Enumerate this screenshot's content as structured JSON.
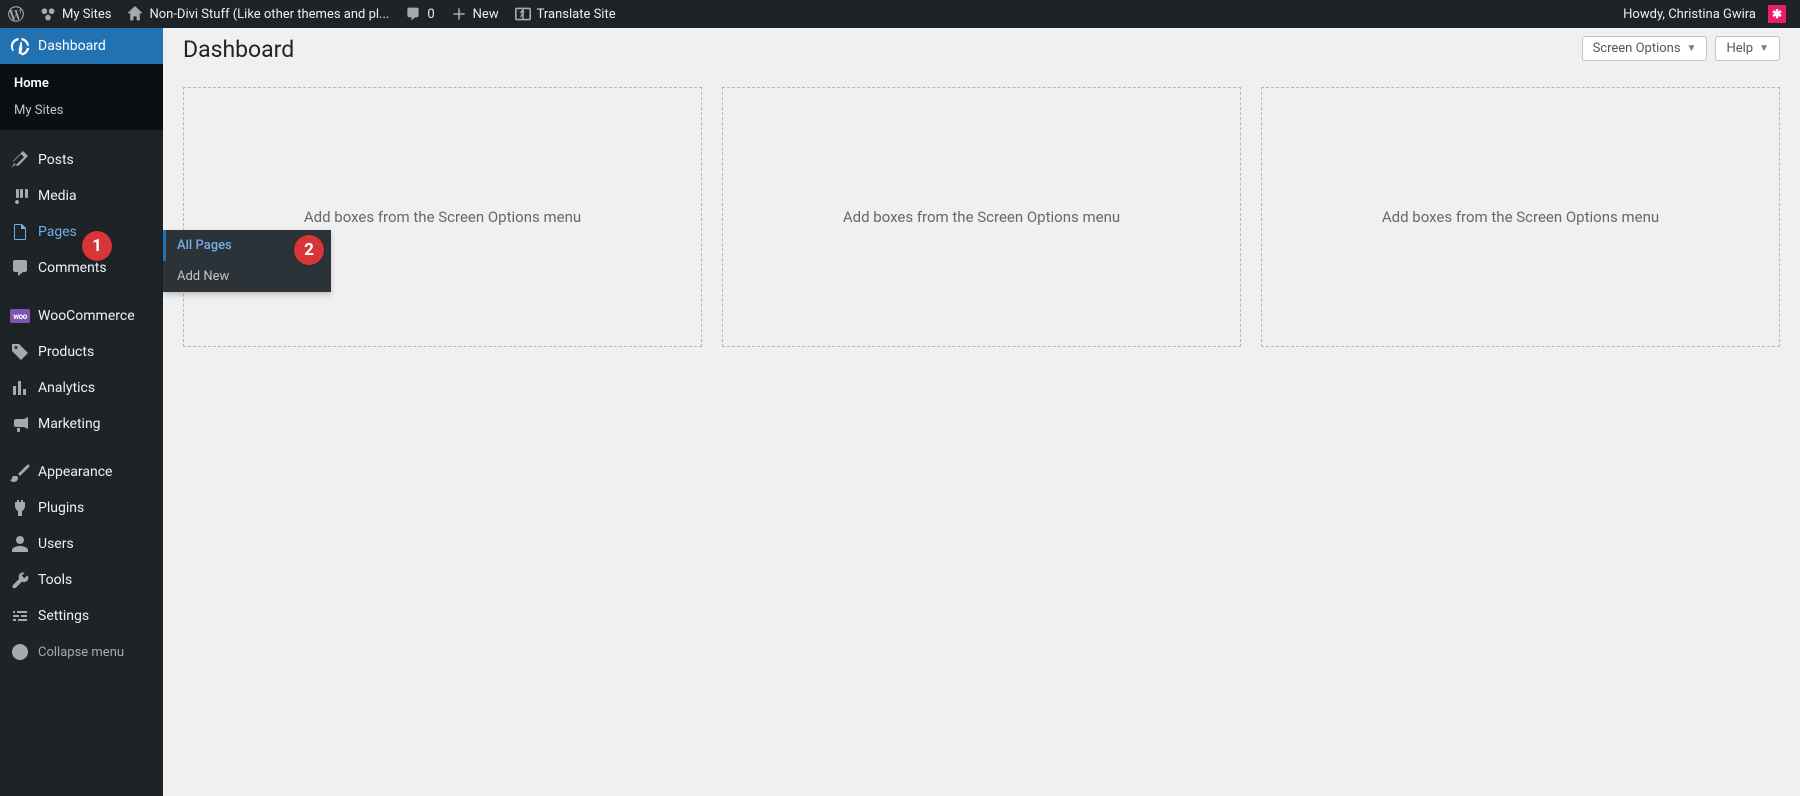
{
  "adminbar": {
    "my_sites": "My Sites",
    "site_name": "Non-Divi Stuff (Like other themes and pl...",
    "comments_count": "0",
    "new_label": "New",
    "translate_label": "Translate Site",
    "howdy_text": "Howdy, Christina Gwira",
    "avatar_initial": "✱"
  },
  "menu": {
    "dashboard": "Dashboard",
    "dash_sub_home": "Home",
    "dash_sub_mysites": "My Sites",
    "posts": "Posts",
    "media": "Media",
    "pages": "Pages",
    "comments": "Comments",
    "woocommerce": "WooCommerce",
    "products": "Products",
    "analytics": "Analytics",
    "marketing": "Marketing",
    "appearance": "Appearance",
    "plugins": "Plugins",
    "users": "Users",
    "tools": "Tools",
    "settings": "Settings",
    "collapse": "Collapse menu",
    "woo_icon_text": "woo"
  },
  "flyout": {
    "all_pages": "All Pages",
    "add_new": "Add New"
  },
  "badges": {
    "one": "1",
    "two": "2"
  },
  "content": {
    "title": "Dashboard",
    "screen_options": "Screen Options",
    "help": "Help",
    "dropzone_text": "Add boxes from the Screen Options menu"
  }
}
